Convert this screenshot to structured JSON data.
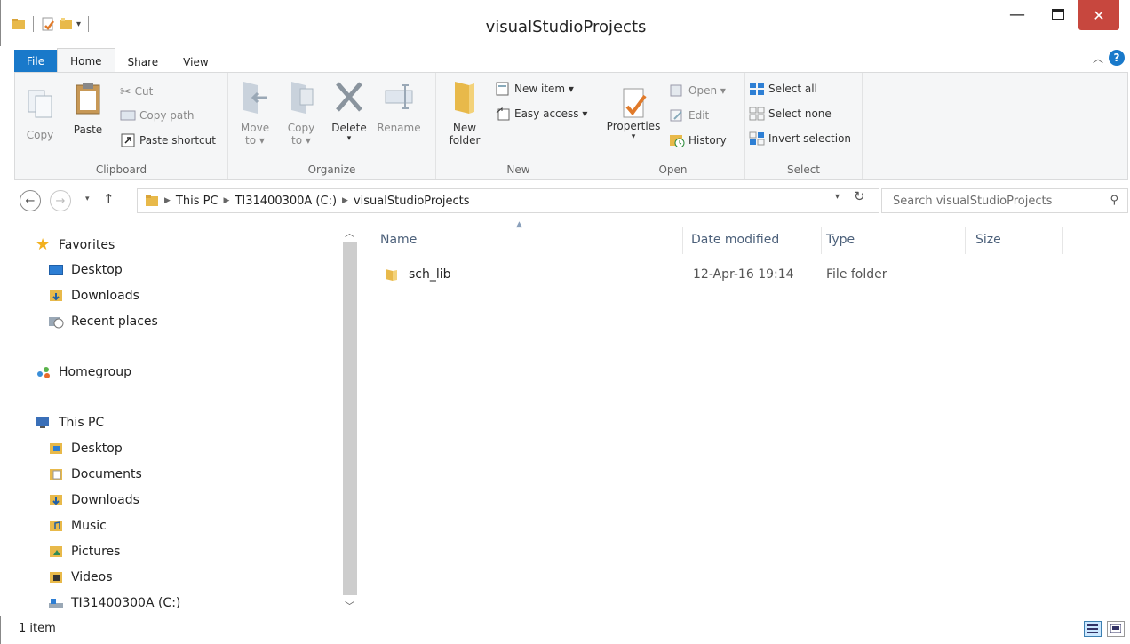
{
  "window": {
    "title": "visualStudioProjects"
  },
  "tabs": {
    "file": "File",
    "home": "Home",
    "share": "Share",
    "view": "View"
  },
  "ribbon": {
    "clipboard": {
      "label": "Clipboard",
      "copy": "Copy",
      "paste": "Paste",
      "cut": "Cut",
      "copy_path": "Copy path",
      "paste_shortcut": "Paste shortcut"
    },
    "organize": {
      "label": "Organize",
      "move_to": "Move",
      "move_to_2": "to ▾",
      "copy_to": "Copy",
      "copy_to_2": "to ▾",
      "delete": "Delete",
      "delete_arrow": "▾",
      "rename": "Rename"
    },
    "new": {
      "label": "New",
      "new_folder": "New",
      "new_folder_2": "folder",
      "new_item": "New item ▾",
      "easy_access": "Easy access ▾"
    },
    "open": {
      "label": "Open",
      "properties": "Properties",
      "properties_arrow": "▾",
      "open": "Open ▾",
      "edit": "Edit",
      "history": "History"
    },
    "select": {
      "label": "Select",
      "select_all": "Select all",
      "select_none": "Select none",
      "invert_selection": "Invert selection"
    }
  },
  "address": {
    "crumbs": [
      "This PC",
      "TI31400300A (C:)",
      "visualStudioProjects"
    ],
    "search_placeholder": "Search visualStudioProjects"
  },
  "navpane": {
    "favorites": "Favorites",
    "fav_items": [
      "Desktop",
      "Downloads",
      "Recent places"
    ],
    "homegroup": "Homegroup",
    "this_pc": "This PC",
    "pc_items": [
      "Desktop",
      "Documents",
      "Downloads",
      "Music",
      "Pictures",
      "Videos",
      "TI31400300A (C:)"
    ]
  },
  "content": {
    "columns": {
      "name": "Name",
      "date_modified": "Date modified",
      "type": "Type",
      "size": "Size"
    },
    "files": [
      {
        "name": "sch_lib",
        "date": "12-Apr-16 19:14",
        "type": "File folder",
        "size": ""
      }
    ]
  },
  "status": {
    "text": "1 item"
  },
  "colors": {
    "file_tab": "#1979ca",
    "close_button": "#c7473e",
    "folder": "#e8b94a"
  }
}
